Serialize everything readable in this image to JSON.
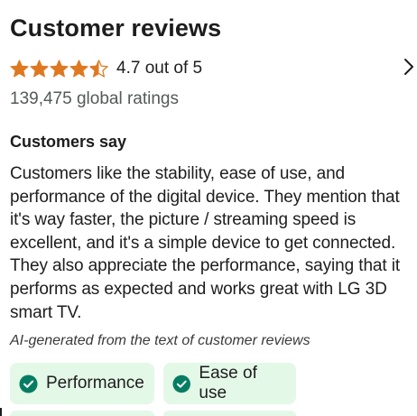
{
  "header": {
    "title": "Customer reviews"
  },
  "rating": {
    "stars_value": 4.7,
    "stars_max": 5,
    "text": "4.7 out of 5",
    "star_color": "#de7921"
  },
  "global_ratings": "139,475 global ratings",
  "customers_say": {
    "heading": "Customers say",
    "summary": "Customers like the stability, ease of use, and performance of the digital device. They mention that it's way faster, the picture / streaming speed is excellent, and it's a simple device to get connected. They also appreciate the performance, saying that it performs as expected and works great with LG 3D smart TV.",
    "ai_note": "AI-generated from the text of customer reviews"
  },
  "chips": [
    {
      "label": "Performance",
      "icon": "check-circle-icon"
    },
    {
      "label": "Ease of use",
      "icon": "check-circle-icon"
    }
  ],
  "colors": {
    "chip_background": "#e4f8e8",
    "check_icon": "#067d62"
  },
  "icons": {
    "chevron": "chevron-right-icon"
  }
}
